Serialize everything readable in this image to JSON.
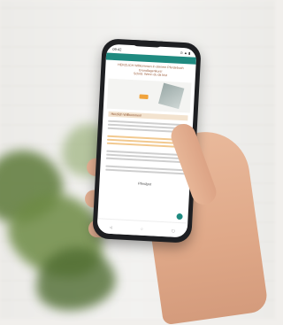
{
  "scene": {
    "description": "Hand holding a smartphone showing a coaching web page, blurred plant and wall background"
  },
  "phone": {
    "status_time": "09:42",
    "status_icons": "⊙ ▲ ▮",
    "header_text": "HERZLICH Willkommen in deinem Pferdebuch Grundlagenkurs!",
    "header_sub": "Schritt: Wenn du da bist",
    "section_title": "Herzlich Willkommen!",
    "signature": "Pferdgut",
    "nav": {
      "back": "◁",
      "home": "○",
      "menu": "▢"
    }
  }
}
